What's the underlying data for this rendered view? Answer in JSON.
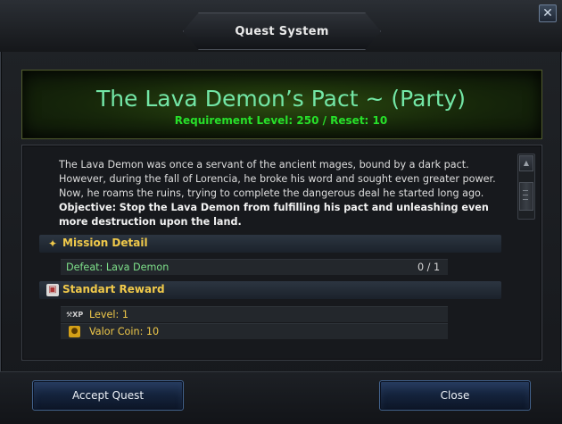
{
  "window": {
    "title": "Quest System",
    "close_label": "✕"
  },
  "quest": {
    "title": "The Lava Demon’s Pact ~ (Party)",
    "requirement": "Requirement Level: 250 / Reset: 10",
    "description": "The Lava Demon was once a servant of the ancient mages, bound by a dark pact. However, during the fall of Lorencia, he broke his word and sought even greater power. Now, he roams the ruins, trying to complete the dangerous deal he started long ago.",
    "objective_label": "Objective:",
    "objective_text": "Stop the Lava Demon from fulfilling his pact and unleashing even more destruction upon the land."
  },
  "mission": {
    "heading": "Mission Detail",
    "icon": "arrow-up-icon",
    "task": "Defeat: Lava Demon",
    "progress": "0 / 1"
  },
  "reward": {
    "heading": "Standart Reward",
    "icon": "gift-box-icon",
    "items": [
      {
        "icon": "xp-icon",
        "text": "Level: 1"
      },
      {
        "icon": "valor-coin-icon",
        "text": "Valor Coin: 10"
      }
    ]
  },
  "buttons": {
    "accept": "Accept Quest",
    "close": "Close"
  },
  "colors": {
    "title_green": "#73e6a6",
    "requirement_green": "#27e02a",
    "section_gold": "#f0c94a",
    "task_green": "#7ee08a",
    "reward_gold": "#f0c94a"
  }
}
